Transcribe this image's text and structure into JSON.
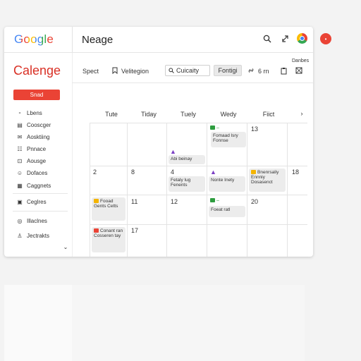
{
  "header": {
    "logo": "Google",
    "page_title": "Neage"
  },
  "app": {
    "title": "Calenge",
    "create_label": "Snad"
  },
  "toolbar": {
    "search_label": "Spect",
    "view_label": "Velitegion",
    "search_box": "Cuicaity",
    "settings_label": "Fontigi",
    "zoom_label": "6 rn",
    "corner_label": "Danbes"
  },
  "sidebar": {
    "items": [
      {
        "label": "Lbens",
        "icon": "list-icon"
      },
      {
        "label": "Cooscger",
        "icon": "calendar-icon"
      },
      {
        "label": "Aosktiing",
        "icon": "mail-icon"
      },
      {
        "label": "Pnnace",
        "icon": "people-icon"
      },
      {
        "label": "Aousge",
        "icon": "lock-icon"
      },
      {
        "label": "Dofaces",
        "icon": "contacts-icon"
      },
      {
        "label": "Caggnets",
        "icon": "grid-icon"
      },
      {
        "label": "Ceglres",
        "icon": "document-icon"
      },
      {
        "label": "Illaclnes",
        "icon": "target-icon"
      },
      {
        "label": "Jectrakts",
        "icon": "person-icon"
      }
    ]
  },
  "calendar": {
    "days": [
      "Tute",
      "Tiday",
      "Tuely",
      "Wedy",
      "Fiict"
    ],
    "day_numbers": {
      "r1c5": "13",
      "r2c1": "2",
      "r2c2": "8",
      "r2c3": "4",
      "r2c6": "18",
      "r3c2": "11",
      "r3c3": "12",
      "r3c5": "20",
      "r4c2": "17"
    },
    "events": {
      "e1": "Fomaad lsry Fonnse",
      "e2": "Abi beinay",
      "e3": "Fetaly lug Fenents",
      "e4": "Nonte Inety",
      "e5": "Bnenrsaliy Ennniy Dosasenct",
      "e6": "Fooad Gents Cetts",
      "e7": "Foeat ratl",
      "e8": "Conant ran Cosseren tay"
    }
  },
  "colors": {
    "accent_red": "#ea4335",
    "purple": "#7b3fc4",
    "green": "#2e9d3f",
    "yellow": "#f4b400"
  }
}
